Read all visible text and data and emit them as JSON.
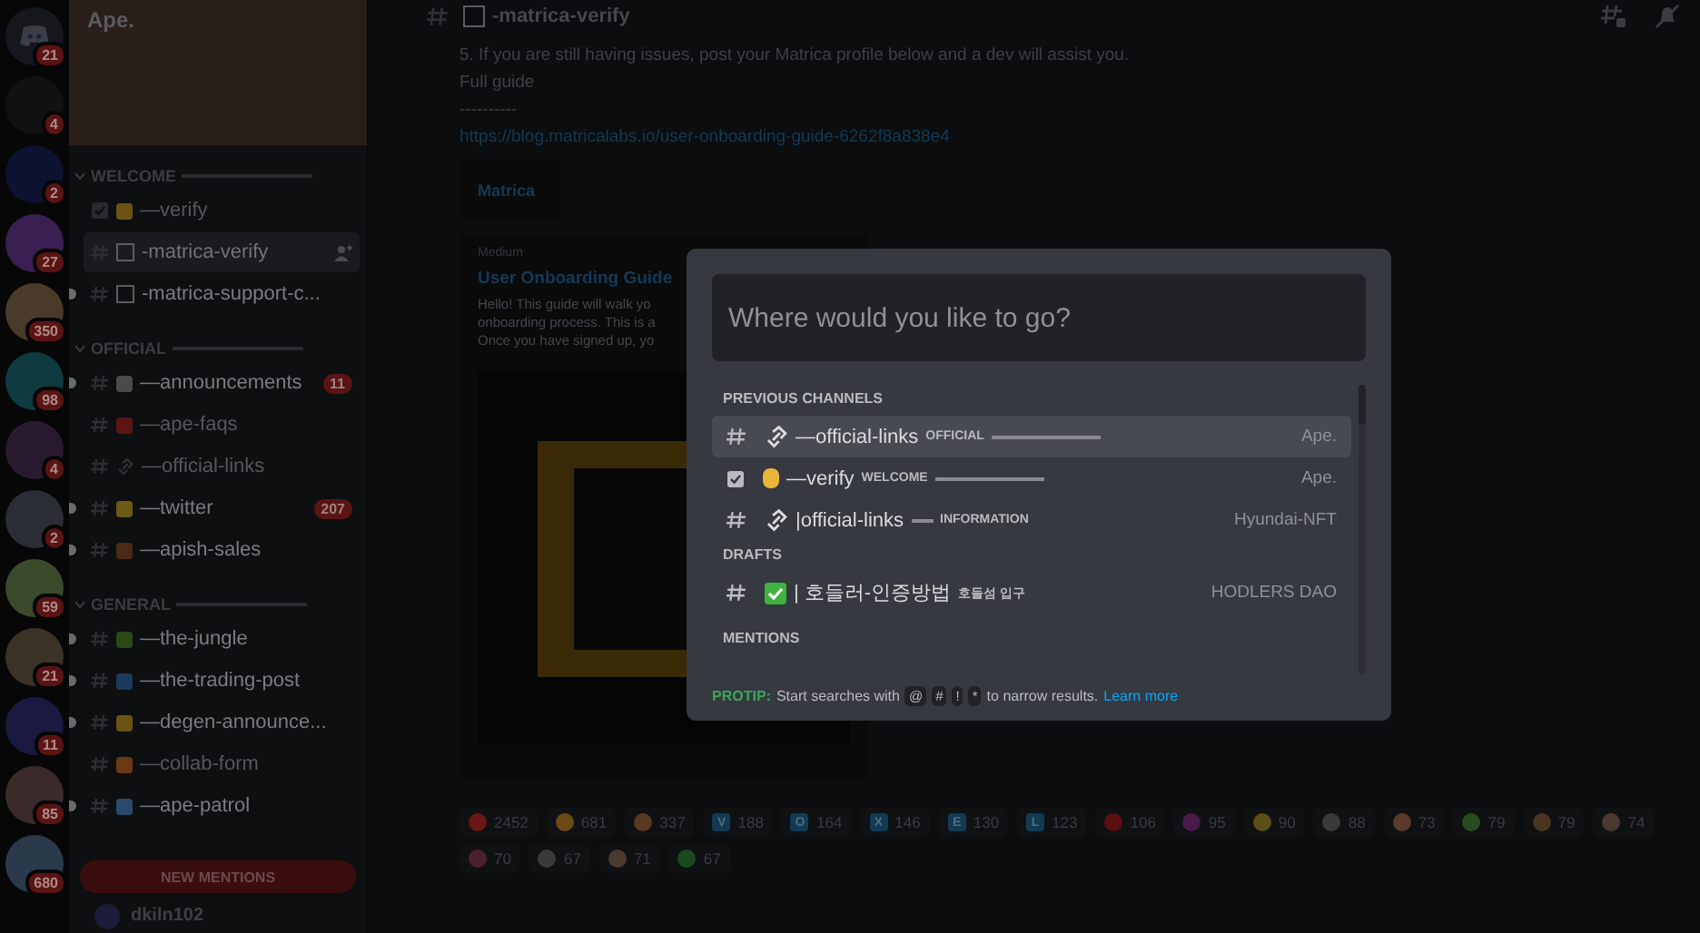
{
  "servers": [
    {
      "kind": "home",
      "badge": "21"
    },
    {
      "kind": "server",
      "badge": "4"
    },
    {
      "kind": "server",
      "badge": "2"
    },
    {
      "kind": "server",
      "badge": "27"
    },
    {
      "kind": "server",
      "badge": "350"
    },
    {
      "kind": "server",
      "badge": "98"
    },
    {
      "kind": "server",
      "badge": "4"
    },
    {
      "kind": "server",
      "badge": "2"
    },
    {
      "kind": "server",
      "badge": "59"
    },
    {
      "kind": "server",
      "badge": "21"
    },
    {
      "kind": "server",
      "badge": "11"
    },
    {
      "kind": "server",
      "badge": "85"
    },
    {
      "kind": "server",
      "badge": "680"
    }
  ],
  "sidebar": {
    "server_name": "Ape.",
    "categories": [
      {
        "name": "WELCOME",
        "expanded": true,
        "channels": [
          {
            "kind": "rules",
            "name": "—verify",
            "unread": false,
            "selected": false,
            "muted": true
          },
          {
            "kind": "text",
            "name": "-matrica-verify",
            "unread": false,
            "selected": true,
            "muted": false
          },
          {
            "kind": "text",
            "name": "-matrica-support-c...",
            "unread": true,
            "selected": false,
            "muted": false
          }
        ]
      },
      {
        "name": "OFFICIAL",
        "expanded": true,
        "channels": [
          {
            "kind": "text",
            "name": "—announcements",
            "unread": true,
            "selected": false,
            "muted": false,
            "badge": "11"
          },
          {
            "kind": "text",
            "name": "—ape-faqs",
            "unread": false,
            "selected": false,
            "muted": true
          },
          {
            "kind": "text",
            "name": "—official-links",
            "unread": false,
            "selected": false,
            "muted": true
          },
          {
            "kind": "text",
            "name": "—twitter",
            "unread": true,
            "selected": false,
            "muted": false,
            "badge": "207"
          },
          {
            "kind": "text",
            "name": "—apish-sales",
            "unread": true,
            "selected": false,
            "muted": false
          }
        ]
      },
      {
        "name": "GENERAL",
        "expanded": true,
        "channels": [
          {
            "kind": "text",
            "name": "—the-jungle",
            "unread": true,
            "selected": false,
            "muted": false
          },
          {
            "kind": "text",
            "name": "—the-trading-post",
            "unread": true,
            "selected": false,
            "muted": false
          },
          {
            "kind": "text",
            "name": "—degen-announce...",
            "unread": true,
            "selected": false,
            "muted": false
          },
          {
            "kind": "text",
            "name": "—collab-form",
            "unread": false,
            "selected": false,
            "muted": true
          },
          {
            "kind": "text",
            "name": "—ape-patrol",
            "unread": true,
            "selected": false,
            "muted": false
          }
        ]
      }
    ],
    "mentions_button": "NEW MENTIONS",
    "username": "dkiln102"
  },
  "channel_header": {
    "name": "-matrica-verify"
  },
  "message": {
    "lines": [
      "5. If you are still having issues, post your Matrica profile below and a dev will assist you.",
      "Full guide",
      "----------"
    ],
    "link": "https://blog.matricalabs.io/user-onboarding-guide-6262f8a838e4",
    "embed_small": {
      "title": "Matrica"
    },
    "embed": {
      "provider": "Medium",
      "title": "User Onboarding Guide",
      "description": [
        "Hello! This guide will walk yo",
        "onboarding process. This is a",
        "Once you have signed up, yo"
      ]
    }
  },
  "reactions": [
    {
      "kind": "emoji",
      "count": "2452"
    },
    {
      "kind": "emoji",
      "count": "681"
    },
    {
      "kind": "emoji",
      "count": "337"
    },
    {
      "kind": "letter",
      "letter": "V",
      "count": "188"
    },
    {
      "kind": "letter",
      "letter": "O",
      "count": "164"
    },
    {
      "kind": "letter",
      "letter": "X",
      "count": "146"
    },
    {
      "kind": "letter",
      "letter": "E",
      "count": "130"
    },
    {
      "kind": "letter",
      "letter": "L",
      "count": "123"
    },
    {
      "kind": "emoji",
      "count": "106"
    },
    {
      "kind": "emoji",
      "count": "95"
    },
    {
      "kind": "emoji",
      "count": "90"
    },
    {
      "kind": "emoji",
      "count": "88"
    },
    {
      "kind": "emoji",
      "count": "73"
    },
    {
      "kind": "emoji",
      "count": "79"
    },
    {
      "kind": "emoji",
      "count": "79"
    },
    {
      "kind": "emoji",
      "count": "74"
    },
    {
      "kind": "emoji",
      "count": "70"
    },
    {
      "kind": "emoji",
      "count": "67"
    },
    {
      "kind": "emoji",
      "count": "71"
    },
    {
      "kind": "emoji",
      "count": "67"
    }
  ],
  "quick_switcher": {
    "placeholder": "Where would you like to go?",
    "sections": [
      {
        "title": "PREVIOUS CHANNELS",
        "items": [
          {
            "kind": "text",
            "name": "—official-links",
            "category": "OFFICIAL",
            "rule_before": false,
            "rule_after": true,
            "server": "Ape.",
            "selected": true
          },
          {
            "kind": "rules",
            "name": "—verify",
            "category": "WELCOME",
            "rule_before": false,
            "rule_after": true,
            "server": "Ape.",
            "selected": false
          },
          {
            "kind": "text",
            "name": "|official-links",
            "category": "INFORMATION",
            "rule_before": true,
            "rule_after": false,
            "server": "Hyundai-NFT",
            "selected": false
          }
        ]
      },
      {
        "title": "DRAFTS",
        "items": [
          {
            "kind": "text",
            "name": "| 호들러-인증방법",
            "category": "호들섬 입구",
            "rule_before": false,
            "rule_after": false,
            "server": "HODLERS DAO",
            "selected": false
          }
        ]
      },
      {
        "title": "MENTIONS"
      }
    ],
    "protip": {
      "label": "PROTIP:",
      "before": "Start searches with",
      "keys": [
        "@",
        "#",
        "!",
        "*"
      ],
      "after": "to narrow results.",
      "link": "Learn more"
    }
  }
}
